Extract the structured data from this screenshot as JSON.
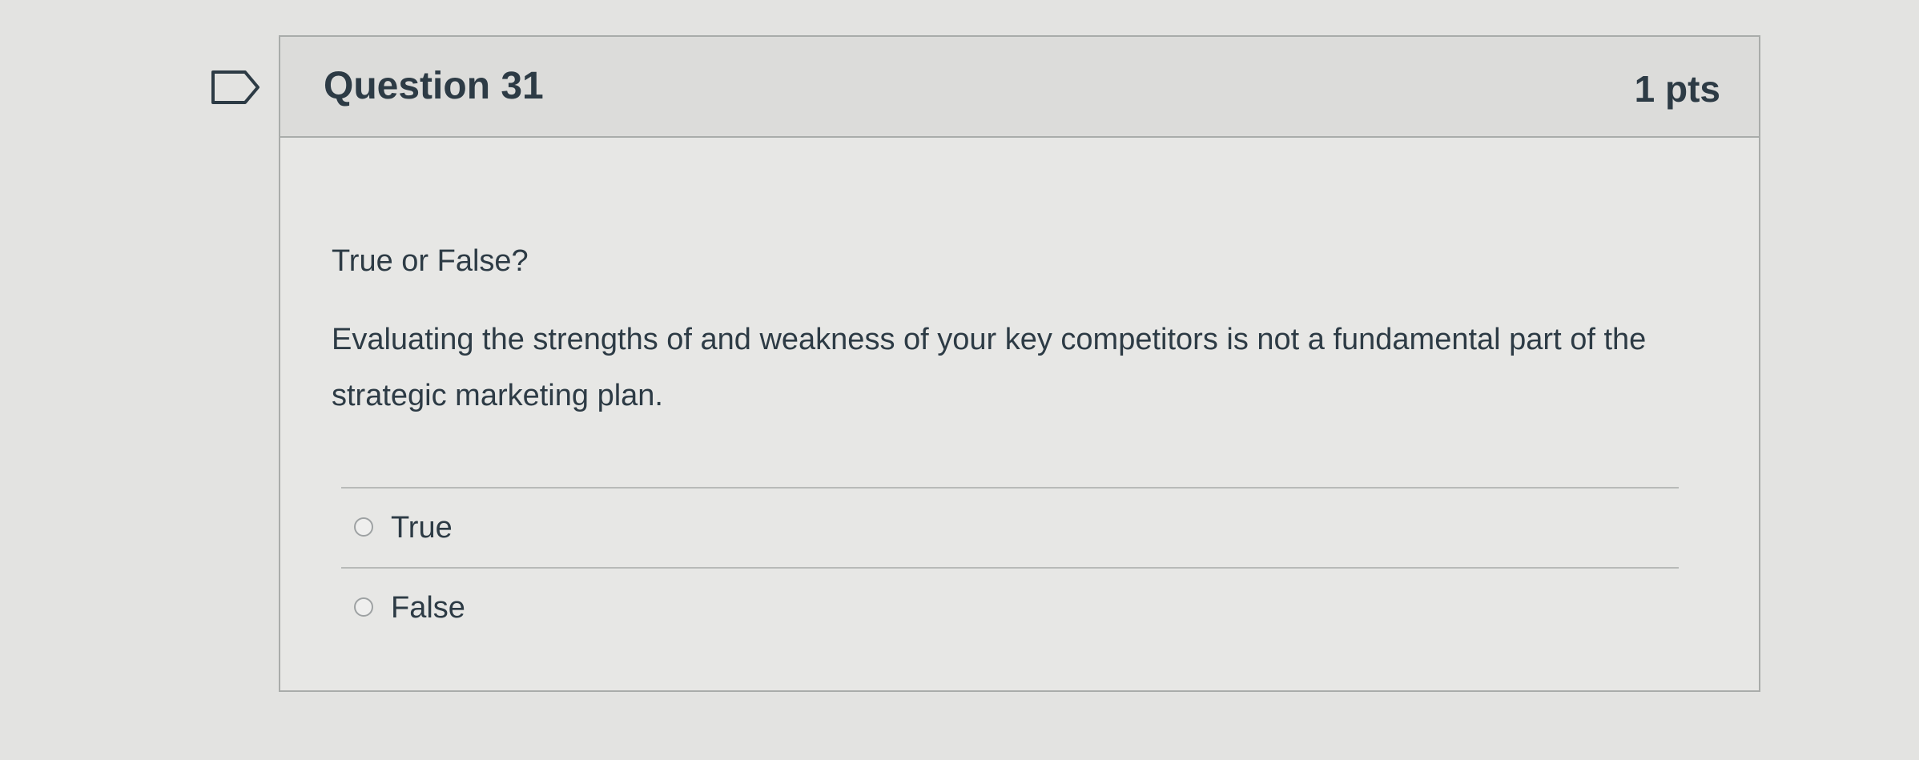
{
  "question": {
    "title": "Question 31",
    "points": "1 pts",
    "prompt": "True or False?",
    "text": "Evaluating the strengths of and weakness of your key competitors is not a fundamental part of the strategic marketing plan."
  },
  "answers": [
    {
      "label": "True",
      "selected": false
    },
    {
      "label": "False",
      "selected": false
    }
  ],
  "colors": {
    "text": "#2d3b45",
    "border": "#a9acaa",
    "header_bg": "#dcdcda"
  },
  "icons": {
    "flag": "flag-outline-icon",
    "radio": "radio-unchecked-icon"
  }
}
